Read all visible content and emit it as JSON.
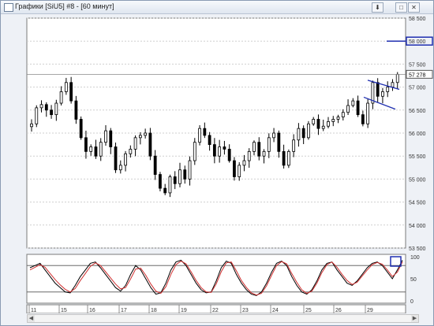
{
  "window": {
    "title": "Графики [SiU5] #8 - [60 минут]",
    "pin_icon": "pin-icon",
    "maximize_icon": "maximize-icon",
    "close_icon": "close-icon"
  },
  "chart_data": [
    {
      "type": "candlestick",
      "name_shown": "",
      "ylim": [
        53500,
        58500
      ],
      "y_ticks": [
        "58 500",
        "58 000",
        "57 500",
        "57 000",
        "56 500",
        "56 000",
        "55 500",
        "55 000",
        "54 500",
        "54 000",
        "53 500"
      ],
      "y_tick_values": [
        58500,
        58000,
        57500,
        57000,
        56500,
        56000,
        55500,
        55000,
        54500,
        54000,
        53500
      ],
      "current_price_label": "57 278",
      "current_price": 57278,
      "highlight_label": "58 000",
      "x_ticks": [
        "11",
        "15",
        "16",
        "17",
        "18",
        "19",
        "22",
        "23",
        "24",
        "25",
        "26",
        "29"
      ],
      "grid": true,
      "colors": {
        "up": "#ffffff",
        "down": "#000000",
        "line": "#000000",
        "drawing": "#1f2fb0"
      },
      "close_path": [
        56200,
        56550,
        56620,
        56500,
        56400,
        56650,
        56900,
        57100,
        56700,
        56300,
        55900,
        55600,
        55700,
        55500,
        55800,
        56050,
        55700,
        55200,
        55300,
        55550,
        55650,
        55900,
        55950,
        56000,
        55500,
        55100,
        54800,
        54700,
        55050,
        54900,
        55200,
        55000,
        55400,
        55800,
        56100,
        55950,
        55750,
        55500,
        55700,
        55650,
        55400,
        55050,
        55300,
        55400,
        55600,
        55800,
        55500,
        55600,
        55900,
        56000,
        55600,
        55300,
        55600,
        55850,
        56100,
        55900,
        56200,
        56300,
        56100,
        56150,
        56250,
        56300,
        56350,
        56450,
        56600,
        56700,
        56400,
        56200,
        56650,
        57100,
        56800,
        56900,
        57000,
        57100,
        57278
      ]
    },
    {
      "type": "line",
      "name_shown": "",
      "ylim": [
        0,
        100
      ],
      "y_ticks": [
        "100",
        "50",
        "0"
      ],
      "y_tick_values": [
        100,
        50,
        0
      ],
      "levels": [
        80,
        20
      ],
      "series": [
        {
          "color": "#000000",
          "values": [
            75,
            80,
            85,
            70,
            55,
            40,
            30,
            20,
            18,
            35,
            55,
            70,
            85,
            88,
            75,
            60,
            45,
            30,
            22,
            35,
            60,
            80,
            70,
            50,
            30,
            15,
            18,
            40,
            70,
            88,
            92,
            80,
            60,
            40,
            25,
            18,
            20,
            45,
            75,
            90,
            85,
            60,
            40,
            25,
            15,
            12,
            20,
            40,
            65,
            85,
            90,
            80,
            55,
            35,
            20,
            15,
            25,
            45,
            70,
            85,
            88,
            70,
            55,
            40,
            35,
            45,
            60,
            75,
            85,
            88,
            80,
            65,
            50,
            70,
            92
          ]
        },
        {
          "color": "#d03030",
          "values": [
            70,
            76,
            82,
            76,
            62,
            48,
            36,
            26,
            20,
            28,
            46,
            62,
            78,
            86,
            80,
            66,
            52,
            38,
            27,
            30,
            50,
            72,
            74,
            58,
            38,
            22,
            17,
            32,
            60,
            82,
            90,
            84,
            66,
            46,
            30,
            20,
            19,
            38,
            66,
            86,
            88,
            68,
            46,
            30,
            18,
            13,
            17,
            34,
            58,
            80,
            89,
            84,
            62,
            42,
            25,
            17,
            22,
            40,
            64,
            82,
            88,
            76,
            60,
            46,
            37,
            42,
            56,
            70,
            82,
            87,
            83,
            70,
            55,
            65,
            88
          ]
        }
      ]
    }
  ],
  "scrollbar": {
    "left_icon": "arrow-left-icon",
    "right_icon": "arrow-right-icon"
  }
}
